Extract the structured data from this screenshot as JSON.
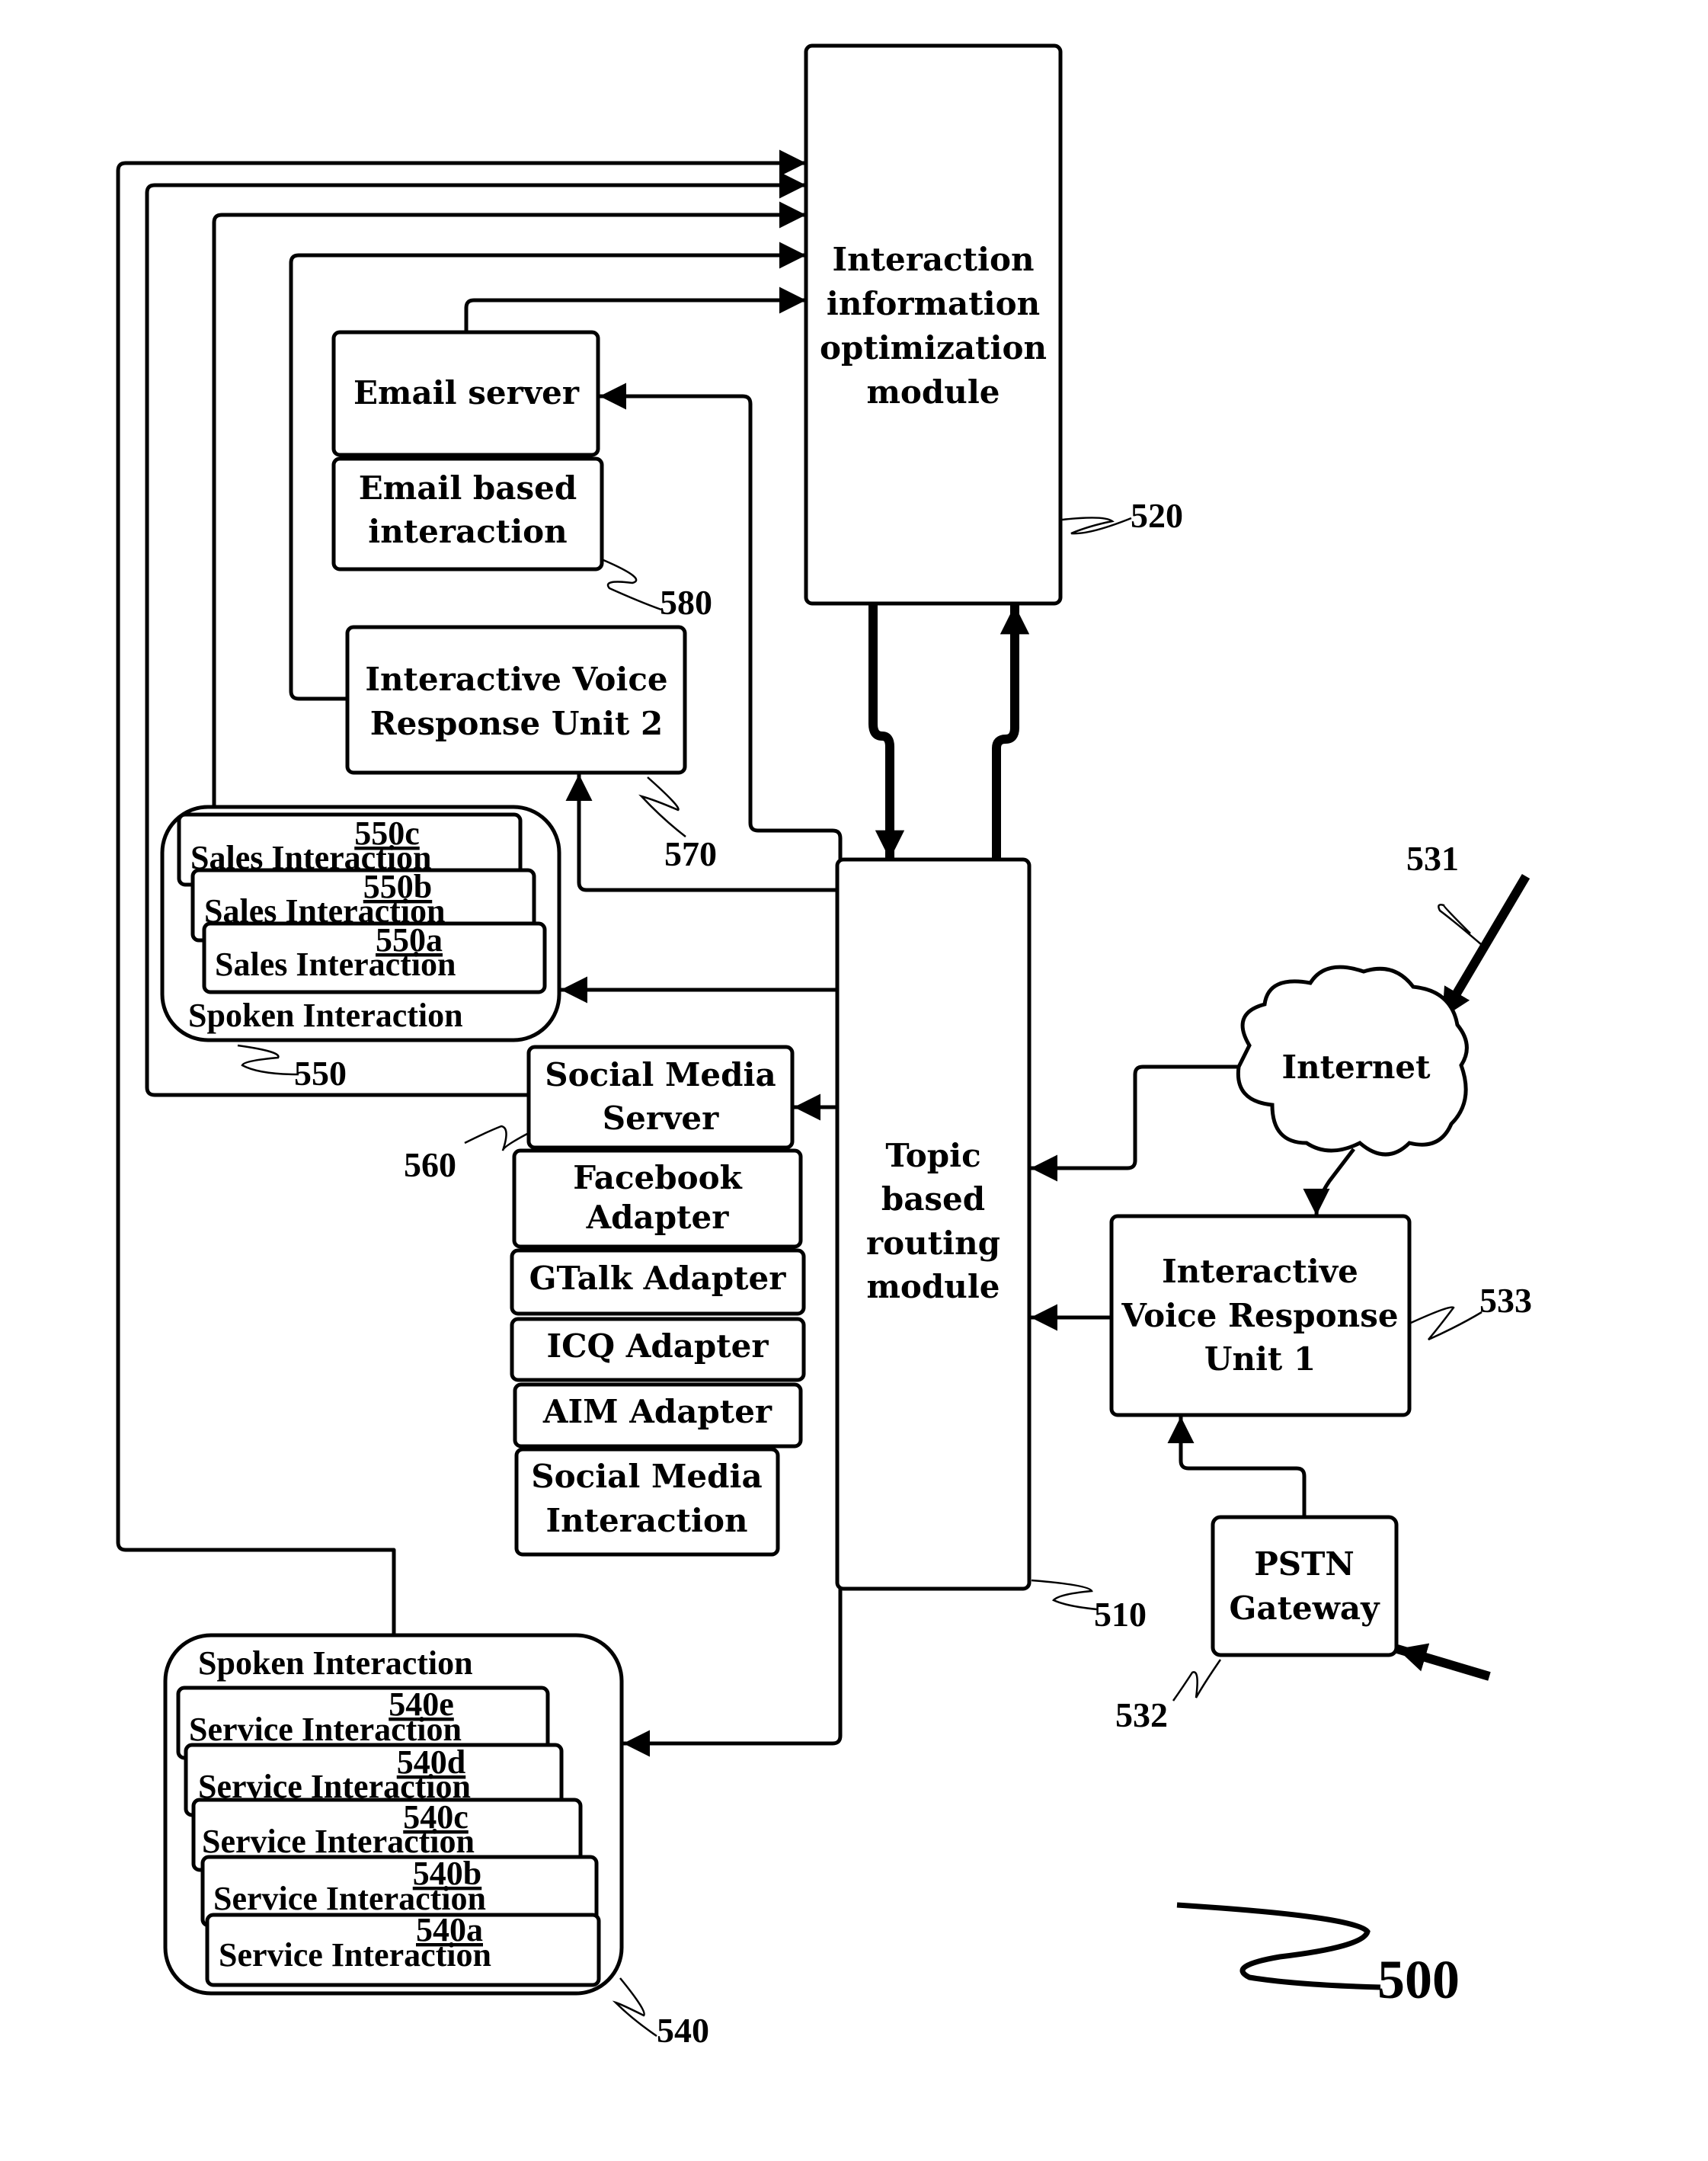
{
  "figure": {
    "reference": "500",
    "colors": {
      "line": "#000000",
      "background": "#ffffff"
    }
  },
  "nodes": {
    "optimization": {
      "lines": [
        "Interaction",
        "information",
        "optimization",
        "module"
      ],
      "ref": "520"
    },
    "routing": {
      "lines": [
        "Topic",
        "based",
        "routing",
        "module"
      ],
      "ref": "510"
    },
    "email_server": {
      "lines": [
        "Email server"
      ]
    },
    "email_interaction": {
      "lines": [
        "Email based",
        "interaction"
      ],
      "ref": "580"
    },
    "ivr2": {
      "lines": [
        "Interactive Voice",
        "Response Unit 2"
      ],
      "ref": "570"
    },
    "sales_group": {
      "title": "Spoken Interaction",
      "ref": "550",
      "items": [
        {
          "tag": "550c",
          "label": "Sales Interaction"
        },
        {
          "tag": "550b",
          "label": "Sales Interaction"
        },
        {
          "tag": "550a",
          "label": "Sales Interaction"
        }
      ]
    },
    "social_server": {
      "lines": [
        "Social Media",
        "Server"
      ],
      "ref": "560"
    },
    "adapters": [
      {
        "lines": [
          "Facebook",
          "Adapter"
        ]
      },
      {
        "lines": [
          "GTalk Adapter"
        ]
      },
      {
        "lines": [
          "ICQ Adapter"
        ]
      },
      {
        "lines": [
          "AIM Adapter"
        ]
      }
    ],
    "social_interaction": {
      "lines": [
        "Social Media",
        "Interaction"
      ]
    },
    "internet": {
      "lines": [
        "Internet"
      ],
      "ref": "531"
    },
    "ivr1": {
      "lines": [
        "Interactive",
        "Voice Response",
        "Unit 1"
      ],
      "ref": "533"
    },
    "pstn": {
      "lines": [
        "PSTN",
        "Gateway"
      ],
      "ref": "532"
    },
    "service_group": {
      "title": "Spoken Interaction",
      "ref": "540",
      "items": [
        {
          "tag": "540e",
          "label": "Service Interaction"
        },
        {
          "tag": "540d",
          "label": "Service Interaction"
        },
        {
          "tag": "540c",
          "label": "Service Interaction"
        },
        {
          "tag": "540b",
          "label": "Service Interaction"
        },
        {
          "tag": "540a",
          "label": "Service Interaction"
        }
      ]
    }
  }
}
